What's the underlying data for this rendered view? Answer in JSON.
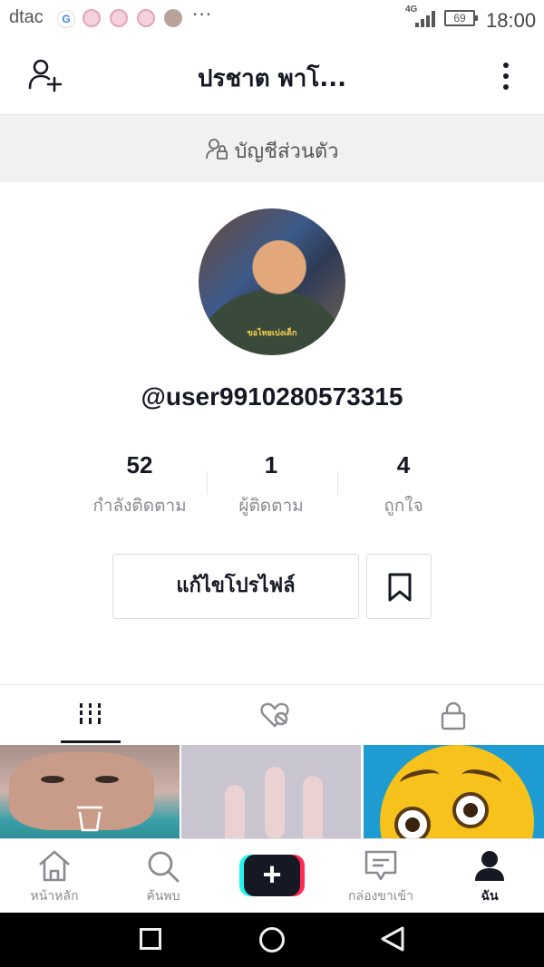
{
  "status_bar": {
    "carrier": "dtac",
    "google_letter": "G",
    "more": "···",
    "network": "4G",
    "battery": "69",
    "time": "18:00"
  },
  "header": {
    "title": "ปรชาต พาโ...",
    "add_user_icon": "add-user-icon",
    "menu_icon": "vertical-dots-icon"
  },
  "private_banner": {
    "icon": "person-lock-icon",
    "label": "บัญชีส่วนตัว"
  },
  "profile": {
    "avatar_caption": "ขอไทยเบ่งเด็ก",
    "username": "@user9910280573315",
    "stats": [
      {
        "value": "52",
        "label": "กำลังติดตาม"
      },
      {
        "value": "1",
        "label": "ผู้ติดตาม"
      },
      {
        "value": "4",
        "label": "ถูกใจ"
      }
    ],
    "edit_button_label": "แก้ไขโปรไฟล์",
    "bookmark_icon": "bookmark-icon"
  },
  "tabs": [
    {
      "icon": "grid-icon",
      "active": true
    },
    {
      "icon": "liked-hidden-icon",
      "active": false
    },
    {
      "icon": "lock-icon",
      "active": false
    }
  ],
  "bottom_nav": [
    {
      "label": "หน้าหลัก",
      "icon": "home-icon",
      "active": false
    },
    {
      "label": "ค้นพบ",
      "icon": "search-icon",
      "active": false
    },
    {
      "label": "",
      "icon": "create-plus-icon",
      "active": false
    },
    {
      "label": "กล่องขาเข้า",
      "icon": "inbox-icon",
      "active": false
    },
    {
      "label": "ฉัน",
      "icon": "profile-icon",
      "active": true
    }
  ],
  "colors": {
    "accent_red": "#fe2c55",
    "accent_cyan": "#25f4ee",
    "text_primary": "#161823",
    "text_secondary": "#8a8b91"
  }
}
